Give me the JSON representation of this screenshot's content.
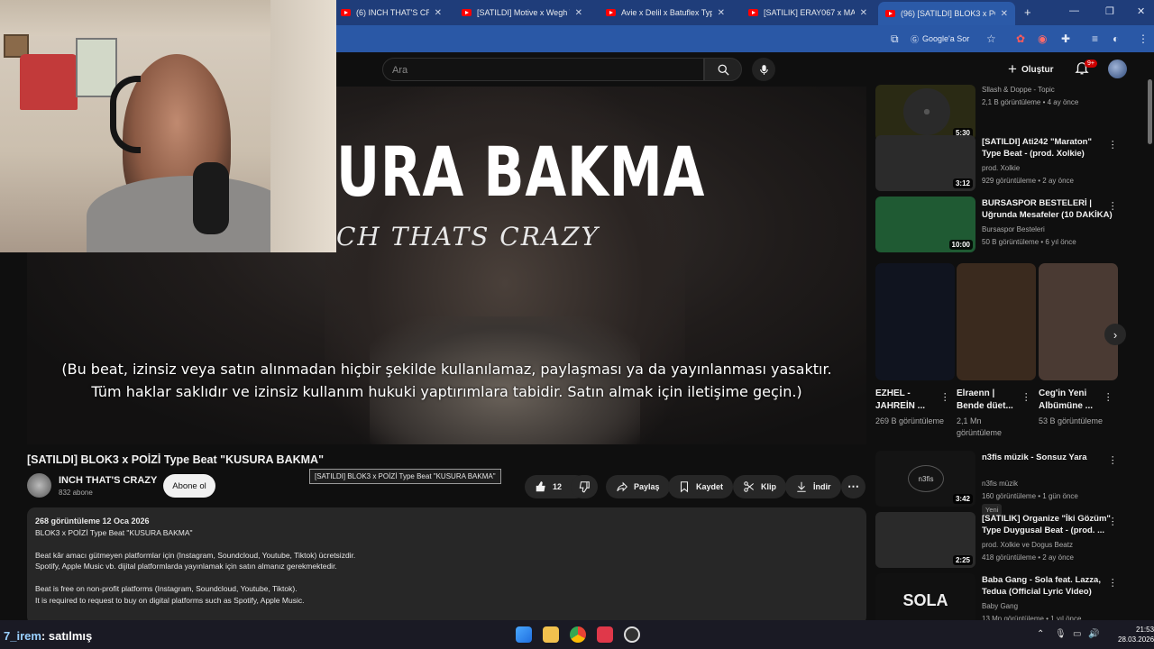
{
  "browser": {
    "tabs": [
      {
        "label": "(6) INCH THAT'S CRAZY - You",
        "active": false
      },
      {
        "label": "[SATILDI] Motive x Wegh Type I",
        "active": false
      },
      {
        "label": "Avie x Delil x Batuflex Type Beat",
        "active": false
      },
      {
        "label": "[SATILIK] ERAY067 x MANSUR",
        "active": false
      },
      {
        "label": "(96) [SATILDI] BLOK3 x POİZİ Typ",
        "active": true
      }
    ],
    "new_tab": "+",
    "google_search": "Google'a Sor"
  },
  "youtube": {
    "search_placeholder": "Ara",
    "create_label": "Oluştur",
    "notification_count": "9+"
  },
  "video": {
    "overlay_title": "URA BAKMA",
    "overlay_sub": "CH THATS CRAZY",
    "caption_line1": "(Bu beat, izinsiz veya satın alınmadan hiçbir şekilde kullanılamaz, paylaşması ya da yayınlanması yasaktır.",
    "caption_line2": "Tüm haklar saklıdır ve izinsiz kullanım hukuki yaptırımlara tabidir. Satın almak için iletişime geçin.)",
    "title": "[SATILDI] BLOK3 x POİZİ Type Beat \"KUSURA BAKMA\"",
    "tooltip": "[SATILDI] BLOK3 x POİZİ Type Beat \"KUSURA BAKMA\"",
    "channel": "INCH THAT'S CRAZY",
    "subscribers": "832 abone",
    "subscribe_label": "Abone ol",
    "likes": "12",
    "share_label": "Paylaş",
    "save_label": "Kaydet",
    "clip_label": "Klip",
    "download_label": "İndir"
  },
  "description": {
    "meta": "268 görüntüleme  12 Oca 2026",
    "lines": [
      "BLOK3 x POİZİ Type Beat \"KUSURA BAKMA\"",
      "",
      "Beat kâr amacı gütmeyen platformlar için (Instagram, Soundcloud, Youtube, Tiktok) ücretsizdir.",
      "Spotify, Apple Music vb. dijital platformlarda yayınlamak için satın almanız gerekmektedir.",
      "",
      "Beat is free on non-profit platforms (Instagram, Soundcloud, Youtube, Tiktok).",
      "It is required to request to buy on digital platforms such as Spotify, Apple Music."
    ]
  },
  "sidebar": {
    "top": [
      {
        "title": "",
        "channel": "Sllash & Doppe - Topic",
        "views": "2,1 B görüntüleme • 4 ay önce",
        "duration": "5:30",
        "color": "#2a2a14"
      },
      {
        "title": "[SATILDI] Ati242 \"Maraton\" Type Beat - (prod. Xolkie)",
        "channel": "prod. Xolkie",
        "views": "929 görüntüleme • 2 ay önce",
        "duration": "3:12",
        "color": "#2b2b2b"
      },
      {
        "title": "BURSASPOR BESTELERİ | Uğrunda Mesafeler (10 DAKİKA)",
        "channel": "Bursaspor Besteleri",
        "views": "50 B görüntüleme • 6 yıl önce",
        "duration": "10:00",
        "color": "#1f5a33"
      }
    ],
    "shorts": [
      {
        "title": "EZHEL - JAHREİN ...",
        "views": "269 B görüntüleme",
        "color": "#10141f"
      },
      {
        "title": "Elraenn | Bende düet...",
        "views": "2,1 Mn görüntüleme",
        "color": "#3a2a1e"
      },
      {
        "title": "Ceg'in Yeni Albümüne ...",
        "views": "53 B görüntüleme",
        "color": "#4a3a33"
      }
    ],
    "bottom": [
      {
        "title": "n3fis müzik - Sonsuz Yara",
        "channel": "n3fis müzik",
        "views": "160 görüntüleme • 1 gün önce",
        "duration": "3:42",
        "badge": "Yeni",
        "color": "#141414"
      },
      {
        "title": "[SATILIK] Organize \"İki Gözüm\" Type Duygusal Beat - (prod. ...",
        "channel": "prod. Xolkie ve Dogus Beatz",
        "views": "418 görüntüleme • 2 ay önce",
        "duration": "2:25",
        "badge": "",
        "color": "#2a2a2a"
      },
      {
        "title": "Baba Gang - Sola feat. Lazza, Tedua (Official Lyric Video)",
        "channel": "Baby Gang",
        "views": "13 Mn görüntüleme • 1 yıl önce",
        "duration": "",
        "badge": "",
        "color": "#111"
      }
    ],
    "bottom_thumb_text": {
      "n3fis": "n3fis",
      "sola": "SOLA"
    }
  },
  "taskbar": {
    "chat_user": "7_irem",
    "chat_msg": ": satılmış",
    "time": "21:53",
    "date": "28.03.2026"
  }
}
